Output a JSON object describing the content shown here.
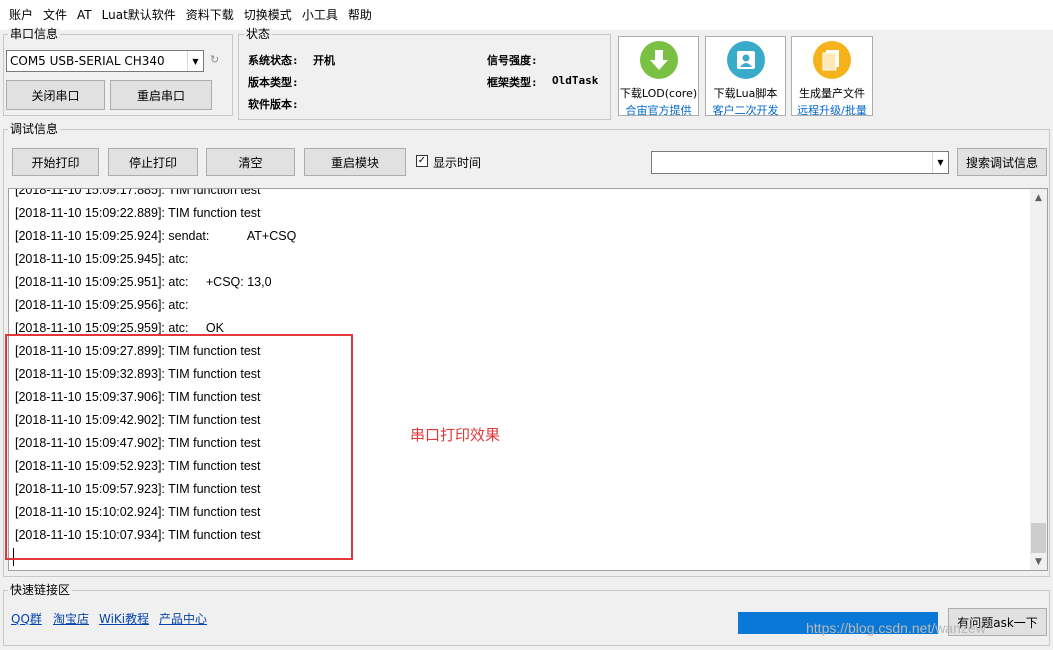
{
  "menu": [
    "账户",
    "文件",
    "AT",
    "Luat默认软件",
    "资料下载",
    "切换模式",
    "小工具",
    "帮助"
  ],
  "serial": {
    "group_title": "串口信息",
    "port": "COM5 USB-SERIAL CH340",
    "close_label": "关闭串口",
    "restart_label": "重启串口"
  },
  "status": {
    "group_title": "状态",
    "sys_state_label": "系统状态:",
    "sys_state_value": "开机",
    "signal_label": "信号强度:",
    "signal_value": "",
    "version_type_label": "版本类型:",
    "version_type_value": "",
    "framework_label": "框架类型:",
    "framework_value": "OldTask",
    "software_version_label": "软件版本:",
    "software_version_value": ""
  },
  "big_buttons": [
    {
      "line1": "下载LOD(core)",
      "line2": "合宙官方提供",
      "color": "#7ac143",
      "icon": "download-arrow-icon"
    },
    {
      "line1": "下载Lua脚本",
      "line2": "客户二次开发",
      "color": "#3aaacb",
      "icon": "upload-person-icon"
    },
    {
      "line1": "生成量产文件",
      "line2": "远程升级/批量",
      "color": "#f5b21b",
      "icon": "document-icon"
    }
  ],
  "debug": {
    "group_title": "调试信息",
    "start_print": "开始打印",
    "stop_print": "停止打印",
    "clear": "清空",
    "restart_module": "重启模块",
    "show_time": "显示时间",
    "show_time_checked": true,
    "search_value": "",
    "search_button": "搜索调试信息"
  },
  "log_lines": [
    "[2018-11-10 15:09:17.885]: TIM function test",
    "[2018-11-10 15:09:22.889]: TIM function test",
    "[2018-11-10 15:09:25.924]: sendat:           AT+CSQ",
    "[2018-11-10 15:09:25.945]: atc:",
    "[2018-11-10 15:09:25.951]: atc:     +CSQ: 13,0",
    "[2018-11-10 15:09:25.956]: atc:",
    "[2018-11-10 15:09:25.959]: atc:     OK",
    "[2018-11-10 15:09:27.899]: TIM function test",
    "[2018-11-10 15:09:32.893]: TIM function test",
    "[2018-11-10 15:09:37.906]: TIM function test",
    "[2018-11-10 15:09:42.902]: TIM function test",
    "[2018-11-10 15:09:47.902]: TIM function test",
    "[2018-11-10 15:09:52.923]: TIM function test",
    "[2018-11-10 15:09:57.923]: TIM function test",
    "[2018-11-10 15:10:02.924]: TIM function test",
    "[2018-11-10 15:10:07.934]: TIM function test"
  ],
  "annotation": "串口打印效果",
  "quick_links": {
    "group_title": "快速链接区",
    "links": [
      "QQ群",
      "淘宝店",
      "WiKi教程",
      "产品中心"
    ]
  },
  "ask_button": "有问题ask一下",
  "watermark": "https://blog.csdn.net/wanzew"
}
